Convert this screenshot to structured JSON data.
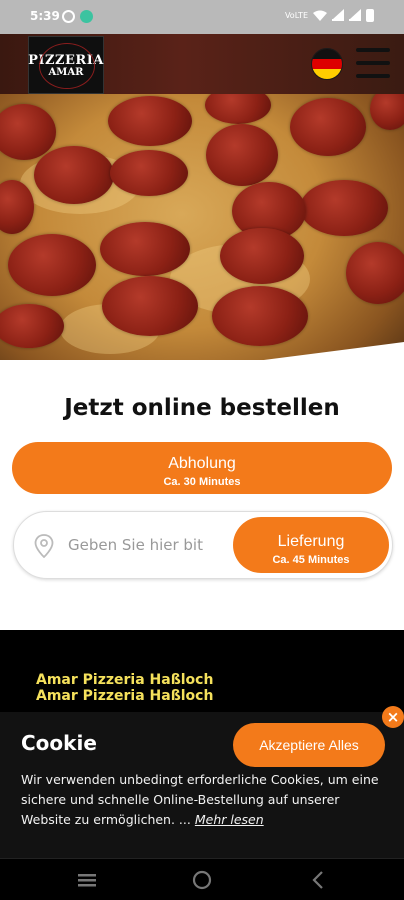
{
  "status_bar": {
    "time": "5:39",
    "icons": [
      "minus-circle-icon",
      "app-icon",
      "volte-icon",
      "wifi-icon",
      "signal-icon",
      "signal-icon",
      "battery-icon"
    ],
    "network": "VoLTE"
  },
  "header": {
    "logo_text": "PIZZERIA",
    "logo_sub": "AMAR",
    "language_icon": "german-flag-icon",
    "menu_icon": "hamburger-menu-icon"
  },
  "main": {
    "title": "Jetzt online bestellen",
    "pickup": {
      "label": "Abholung",
      "time": "Ca. 30 Minutes"
    },
    "delivery": {
      "label": "Lieferung",
      "time": "Ca. 45 Minutes"
    },
    "address_input": {
      "placeholder": "Geben Sie hier bit",
      "value": ""
    }
  },
  "footer": {
    "restaurant_lines": [
      "Amar Pizzeria Haßloch",
      "Amar Pizzeria Haßloch"
    ]
  },
  "cookie": {
    "title": "Cookie",
    "accept_label": "Akzeptiere Alles",
    "close_symbol": "×",
    "text": "Wir verwenden unbedingt erforderliche Cookies, um eine sichere und schnelle Online-Bestellung auf unserer Website zu ermöglichen. ...",
    "more_label": "Mehr lesen"
  },
  "colors": {
    "accent": "#f37a1a",
    "footer_text": "#f5e15c",
    "dark": "#121212"
  },
  "navbar": {
    "icons": [
      "recent-apps-icon",
      "home-icon",
      "back-icon"
    ]
  }
}
